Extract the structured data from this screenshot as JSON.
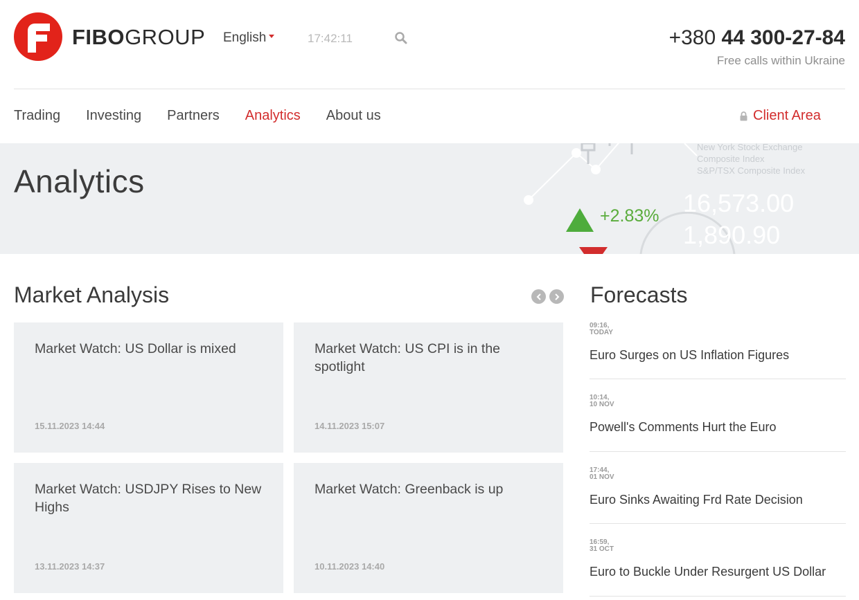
{
  "brand": {
    "name_bold": "FIBO",
    "name_rest": "GROUP",
    "logo_color": "#e2231a"
  },
  "header": {
    "language": "English",
    "clock": "17:42:11",
    "phone_prefix": "+380",
    "phone_number": "44 300-27-84",
    "phone_note": "Free calls within Ukraine"
  },
  "nav": {
    "items": [
      {
        "label": "Trading",
        "active": false
      },
      {
        "label": "Investing",
        "active": false
      },
      {
        "label": "Partners",
        "active": false
      },
      {
        "label": "Analytics",
        "active": true
      },
      {
        "label": "About us",
        "active": false
      }
    ],
    "client_area": "Client Area",
    "accent_color": "#d22d2d"
  },
  "banner": {
    "title": "Analytics",
    "index_labels": [
      "New York Stock Exchange",
      "Composite Index",
      "S&P/TSX Composite Index"
    ],
    "big_values": [
      "16,573.00",
      "1,890.90"
    ],
    "change": "+2.83%",
    "change_color": "#5aac3c"
  },
  "market_analysis": {
    "title": "Market Analysis",
    "cards": [
      {
        "title": "Market Watch: US Dollar is mixed",
        "date": "15.11.2023 14:44"
      },
      {
        "title": "Market Watch: US CPI is in the spotlight",
        "date": "14.11.2023 15:07"
      },
      {
        "title": "Market Watch: USDJPY Rises to New Highs",
        "date": "13.11.2023 14:37"
      },
      {
        "title": "Market Watch: Greenback is up",
        "date": "10.11.2023 14:40"
      }
    ]
  },
  "forecasts": {
    "title": "Forecasts",
    "items": [
      {
        "time": "09:16,",
        "day": "TODAY",
        "headline": "Euro Surges on US Inflation Figures"
      },
      {
        "time": "10:14,",
        "day": "10 NOV",
        "headline": "Powell's Comments Hurt the Euro"
      },
      {
        "time": "17:44,",
        "day": "01 NOV",
        "headline": "Euro Sinks Awaiting Frd Rate Decision"
      },
      {
        "time": "16:59,",
        "day": "31 OCT",
        "headline": "Euro to Buckle Under Resurgent US Dollar"
      }
    ]
  }
}
